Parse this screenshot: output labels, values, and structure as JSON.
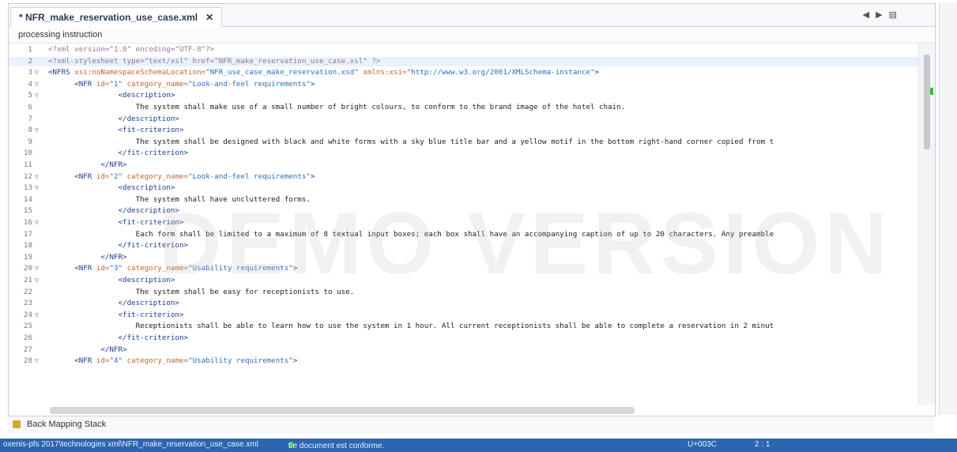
{
  "editor": {
    "tab_title": "* NFR_make_reservation_use_case.xml",
    "tab_close": "✕",
    "breadcrumb": "processing instruction",
    "watermark": "DEMO VERSION",
    "lines": [
      {
        "n": "1",
        "fold": "",
        "parts": [
          {
            "t": "<?xml version=\"1.0\" encoding=\"UTF-8\"?>",
            "c": "pi"
          }
        ]
      },
      {
        "n": "2",
        "fold": "",
        "hl": true,
        "parts": [
          {
            "t": "<?xml-stylesheet type=\"text/xsl\" href=\"NFR_make_reservation_use_case.xsl\" ?>",
            "c": "pi"
          }
        ]
      },
      {
        "n": "3",
        "fold": "▽",
        "parts": [
          {
            "t": "<NFRS ",
            "c": "tag"
          },
          {
            "t": "xsi:noNamespaceSchemaLocation=",
            "c": "attr"
          },
          {
            "t": "\"NFR_use_case_make_reservation.xsd\" ",
            "c": "val"
          },
          {
            "t": "xmlns:xsi=",
            "c": "attr"
          },
          {
            "t": "\"http://www.w3.org/2001/XMLSchema-instance\"",
            "c": "val"
          },
          {
            "t": ">",
            "c": "tag"
          }
        ]
      },
      {
        "n": "4",
        "fold": "▽",
        "parts": [
          {
            "t": "      <NFR ",
            "c": "tag"
          },
          {
            "t": "id=",
            "c": "attr"
          },
          {
            "t": "\"1\" ",
            "c": "val"
          },
          {
            "t": "category_name=",
            "c": "attr"
          },
          {
            "t": "\"Look-and-feel requirements\"",
            "c": "val"
          },
          {
            "t": ">",
            "c": "tag"
          }
        ]
      },
      {
        "n": "5",
        "fold": "▽",
        "parts": [
          {
            "t": "                <description>",
            "c": "tag"
          }
        ]
      },
      {
        "n": "6",
        "fold": "",
        "parts": [
          {
            "t": "                    The system shall make use of a small number of bright colours, to conform to the brand image of the hotel chain.",
            "c": "text"
          }
        ]
      },
      {
        "n": "7",
        "fold": "",
        "parts": [
          {
            "t": "                </description>",
            "c": "tag"
          }
        ]
      },
      {
        "n": "8",
        "fold": "▽",
        "parts": [
          {
            "t": "                <fit-criterion>",
            "c": "tag"
          }
        ]
      },
      {
        "n": "9",
        "fold": "",
        "parts": [
          {
            "t": "                    The system shall be designed with black and white forms with a sky blue title bar and a yellow motif in the bottom right-hand corner copied from t",
            "c": "text"
          }
        ]
      },
      {
        "n": "10",
        "fold": "",
        "parts": [
          {
            "t": "                </fit-criterion>",
            "c": "tag"
          }
        ]
      },
      {
        "n": "11",
        "fold": "",
        "parts": [
          {
            "t": "            </NFR>",
            "c": "tag"
          }
        ]
      },
      {
        "n": "12",
        "fold": "▽",
        "parts": [
          {
            "t": "      <NFR ",
            "c": "tag"
          },
          {
            "t": "id=",
            "c": "attr"
          },
          {
            "t": "\"2\" ",
            "c": "val"
          },
          {
            "t": "category_name=",
            "c": "attr"
          },
          {
            "t": "\"Look-and-feel requirements\"",
            "c": "val"
          },
          {
            "t": ">",
            "c": "tag"
          }
        ]
      },
      {
        "n": "13",
        "fold": "▽",
        "parts": [
          {
            "t": "                <description>",
            "c": "tag"
          }
        ]
      },
      {
        "n": "14",
        "fold": "",
        "parts": [
          {
            "t": "                    The system shall have uncluttered forms.",
            "c": "text"
          }
        ]
      },
      {
        "n": "15",
        "fold": "",
        "parts": [
          {
            "t": "                </description>",
            "c": "tag"
          }
        ]
      },
      {
        "n": "16",
        "fold": "▽",
        "parts": [
          {
            "t": "                <fit-criterion>",
            "c": "tag"
          }
        ]
      },
      {
        "n": "17",
        "fold": "",
        "parts": [
          {
            "t": "                    Each form shall be limited to a maximum of 8 textual input boxes; each box shall have an accompanying caption of up to 20 characters. Any preamble",
            "c": "text"
          }
        ]
      },
      {
        "n": "18",
        "fold": "",
        "parts": [
          {
            "t": "                </fit-criterion>",
            "c": "tag"
          }
        ]
      },
      {
        "n": "19",
        "fold": "",
        "parts": [
          {
            "t": "            </NFR>",
            "c": "tag"
          }
        ]
      },
      {
        "n": "20",
        "fold": "▽",
        "parts": [
          {
            "t": "      <NFR ",
            "c": "tag"
          },
          {
            "t": "id=",
            "c": "attr"
          },
          {
            "t": "\"3\" ",
            "c": "val"
          },
          {
            "t": "category_name=",
            "c": "attr"
          },
          {
            "t": "\"Usability requirements\"",
            "c": "val"
          },
          {
            "t": ">",
            "c": "tag"
          }
        ]
      },
      {
        "n": "21",
        "fold": "▽",
        "parts": [
          {
            "t": "                <description>",
            "c": "tag"
          }
        ]
      },
      {
        "n": "22",
        "fold": "",
        "parts": [
          {
            "t": "                    The system shall be easy for receptionists to use.",
            "c": "text"
          }
        ]
      },
      {
        "n": "23",
        "fold": "",
        "parts": [
          {
            "t": "                </description>",
            "c": "tag"
          }
        ]
      },
      {
        "n": "24",
        "fold": "▽",
        "parts": [
          {
            "t": "                <fit-criterion>",
            "c": "tag"
          }
        ]
      },
      {
        "n": "25",
        "fold": "",
        "parts": [
          {
            "t": "                    Receptionists shall be able to learn how to use the system in 1 hour. All current receptionists shall be able to complete a reservation in 2 minut",
            "c": "text"
          }
        ]
      },
      {
        "n": "26",
        "fold": "",
        "parts": [
          {
            "t": "                </fit-criterion>",
            "c": "tag"
          }
        ]
      },
      {
        "n": "27",
        "fold": "",
        "parts": [
          {
            "t": "            </NFR>",
            "c": "tag"
          }
        ]
      },
      {
        "n": "28",
        "fold": "▽",
        "parts": [
          {
            "t": "      <NFR ",
            "c": "tag"
          },
          {
            "t": "id=",
            "c": "attr"
          },
          {
            "t": "\"4\" ",
            "c": "val"
          },
          {
            "t": "category_name=",
            "c": "attr"
          },
          {
            "t": "\"Usability requirements\"",
            "c": "val"
          },
          {
            "t": ">",
            "c": "tag"
          }
        ]
      }
    ]
  },
  "bottom_panel": {
    "label": "Back Mapping Stack"
  },
  "status_bar": {
    "path": "oxenis-pfs 2017\\technologies xml\\NFR_make_reservation_use_case.xml",
    "validation": "Le document est conforme.",
    "encoding": "U+003C",
    "position": "2 : 1"
  },
  "colors": {
    "status_bar": "#2c65b0",
    "valid_indicator": "#5bd35b"
  }
}
